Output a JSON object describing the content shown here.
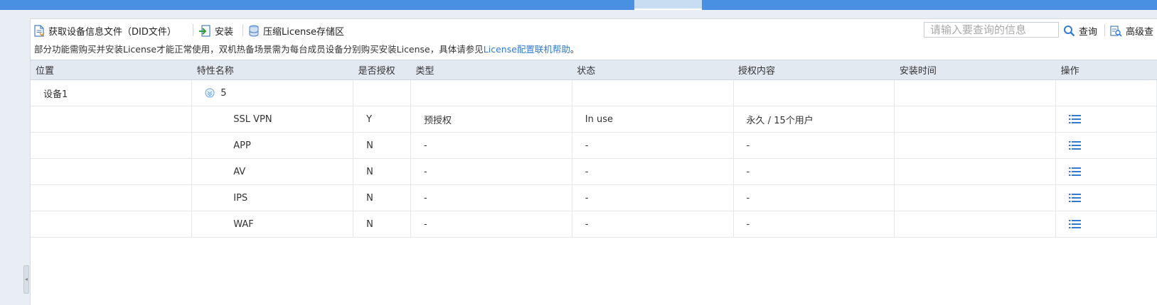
{
  "toolbar": {
    "get_did_label": "获取设备信息文件（DID文件）",
    "install_label": "安装",
    "compress_label": "压缩License存储区",
    "search_placeholder": "请输入要查询的信息",
    "search_label": "查询",
    "advanced_label": "高级查"
  },
  "notice": {
    "text": "部分功能需购买并安装License才能正常使用，双机热备场景需为每台成员设备分别购买安装License，具体请参见",
    "link": "License配置联机帮助",
    "suffix": "。"
  },
  "table": {
    "headers": [
      "位置",
      "特性名称",
      "是否授权",
      "类型",
      "状态",
      "授权内容",
      "安装时间",
      "操作"
    ],
    "group": {
      "position": "设备1",
      "count": "5"
    },
    "rows": [
      {
        "feature": "SSL VPN",
        "authorized": "Y",
        "type": "预授权",
        "status": "In use",
        "content": "永久 / 15个用户",
        "install_time": ""
      },
      {
        "feature": "APP",
        "authorized": "N",
        "type": "-",
        "status": "-",
        "content": "-",
        "install_time": ""
      },
      {
        "feature": "AV",
        "authorized": "N",
        "type": "-",
        "status": "-",
        "content": "-",
        "install_time": ""
      },
      {
        "feature": "IPS",
        "authorized": "N",
        "type": "-",
        "status": "-",
        "content": "-",
        "install_time": ""
      },
      {
        "feature": "WAF",
        "authorized": "N",
        "type": "-",
        "status": "-",
        "content": "-",
        "install_time": ""
      }
    ]
  },
  "icons": {
    "get_did": "document-icon",
    "install": "install-icon",
    "compress": "database-icon",
    "search": "search-icon",
    "advanced": "advanced-search-icon",
    "expand": "expand-circle-icon",
    "operation": "list-icon"
  },
  "colors": {
    "accent": "#4a90e2",
    "link": "#2f7bd8",
    "header_bg": "#e3e9f1"
  }
}
